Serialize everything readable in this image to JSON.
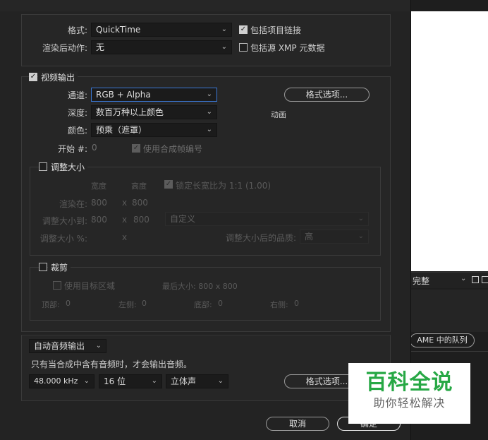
{
  "output": {
    "format_label": "格式:",
    "format_value": "QuickTime",
    "include_project_link_label": "包括项目链接",
    "post_render_label": "渲染后动作:",
    "post_render_value": "无",
    "include_xmp_label": "包括源 XMP 元数据"
  },
  "video": {
    "section_label": "视频输出",
    "channels_label": "通道:",
    "channels_value": "RGB + Alpha",
    "format_options_label": "格式选项...",
    "codec_info": "动画",
    "depth_label": "深度:",
    "depth_value": "数百万种以上颜色",
    "color_label": "颜色:",
    "color_value": "预乘（遮罩）",
    "start_label": "开始 #:",
    "start_value": "0",
    "use_comp_frame_label": "使用合成帧编号"
  },
  "resize": {
    "section_label": "调整大小",
    "width_header": "宽度",
    "height_header": "高度",
    "lock_aspect_label": "锁定长宽比为 1:1 (1.00)",
    "render_at_label": "渲染在:",
    "render_at_w": "800",
    "render_at_x": "x",
    "render_at_h": "800",
    "resize_to_label": "调整大小到:",
    "resize_to_w": "800",
    "resize_to_x": "x",
    "resize_to_h": "800",
    "resize_preset": "自定义",
    "resize_pct_label": "调整大小 %:",
    "resize_pct_x": "x",
    "quality_label": "调整大小后的品质:",
    "quality_value": "高"
  },
  "crop": {
    "section_label": "裁剪",
    "use_roi_label": "使用目标区域",
    "final_size_label": "最后大小: 800 x 800",
    "top_label": "顶部:",
    "top_value": "0",
    "left_label": "左侧:",
    "left_value": "0",
    "bottom_label": "底部:",
    "bottom_value": "0",
    "right_label": "右侧:",
    "right_value": "0"
  },
  "audio": {
    "mode_value": "自动音频输出",
    "info_text": "只有当合成中含有音频时，才会输出音频。",
    "rate_value": "48.000 kHz",
    "bits_value": "16 位",
    "channels_value": "立体声",
    "format_options_label": "格式选项..."
  },
  "footer": {
    "cancel_label": "取消",
    "ok_label": "确定"
  },
  "background": {
    "quality_dropdown": "完整",
    "ame_queue_label": "AME 中的队列"
  },
  "watermark": {
    "title": "百科全说",
    "subtitle": "助你轻松解决"
  }
}
